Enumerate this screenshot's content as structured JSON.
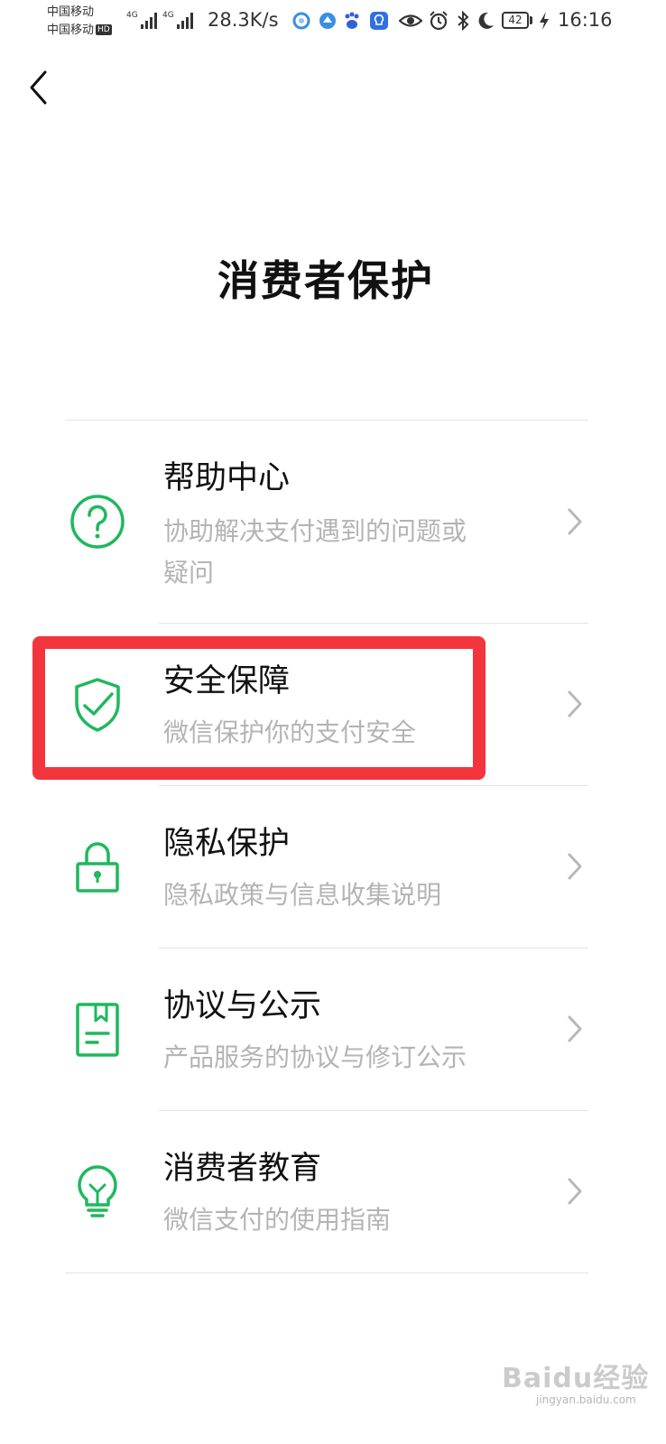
{
  "status_bar": {
    "carrier_1": "中国移动",
    "carrier_2": "中国移动",
    "hd_label": "HD",
    "signal_label_1": "4G",
    "signal_label_2": "4G",
    "net_speed": "28.3K/s",
    "battery": "42",
    "time": "16:16",
    "icons": [
      "notification-app-icon",
      "browser-app-icon",
      "baidu-paw-icon",
      "lightbulb-app-icon",
      "eye-icon",
      "alarm-icon",
      "bluetooth-icon",
      "moon-icon",
      "charging-icon"
    ]
  },
  "nav": {
    "back_icon": "chevron-left-icon"
  },
  "page": {
    "title": "消费者保护"
  },
  "menu": [
    {
      "title": "帮助中心",
      "desc_line1": "协助解决支付遇到的问题或",
      "desc_line2": "疑问",
      "icon": "question-circle-icon"
    },
    {
      "title": "安全保障",
      "desc_line1": "微信保护你的支付安全",
      "icon": "shield-check-icon"
    },
    {
      "title": "隐私保护",
      "desc_line1": "隐私政策与信息收集说明",
      "icon": "lock-icon"
    },
    {
      "title": "协议与公示",
      "desc_line1": "产品服务的协议与修订公示",
      "icon": "document-icon"
    },
    {
      "title": "消费者教育",
      "desc_line1": "微信支付的使用指南",
      "icon": "lightbulb-icon"
    }
  ],
  "colors": {
    "accent_green": "#1fb85d",
    "highlight_red": "#f2353c",
    "desc_gray": "#b4b4b4"
  },
  "watermark": {
    "text": "Baidu经验",
    "sub": "jingyan.baidu.com"
  }
}
